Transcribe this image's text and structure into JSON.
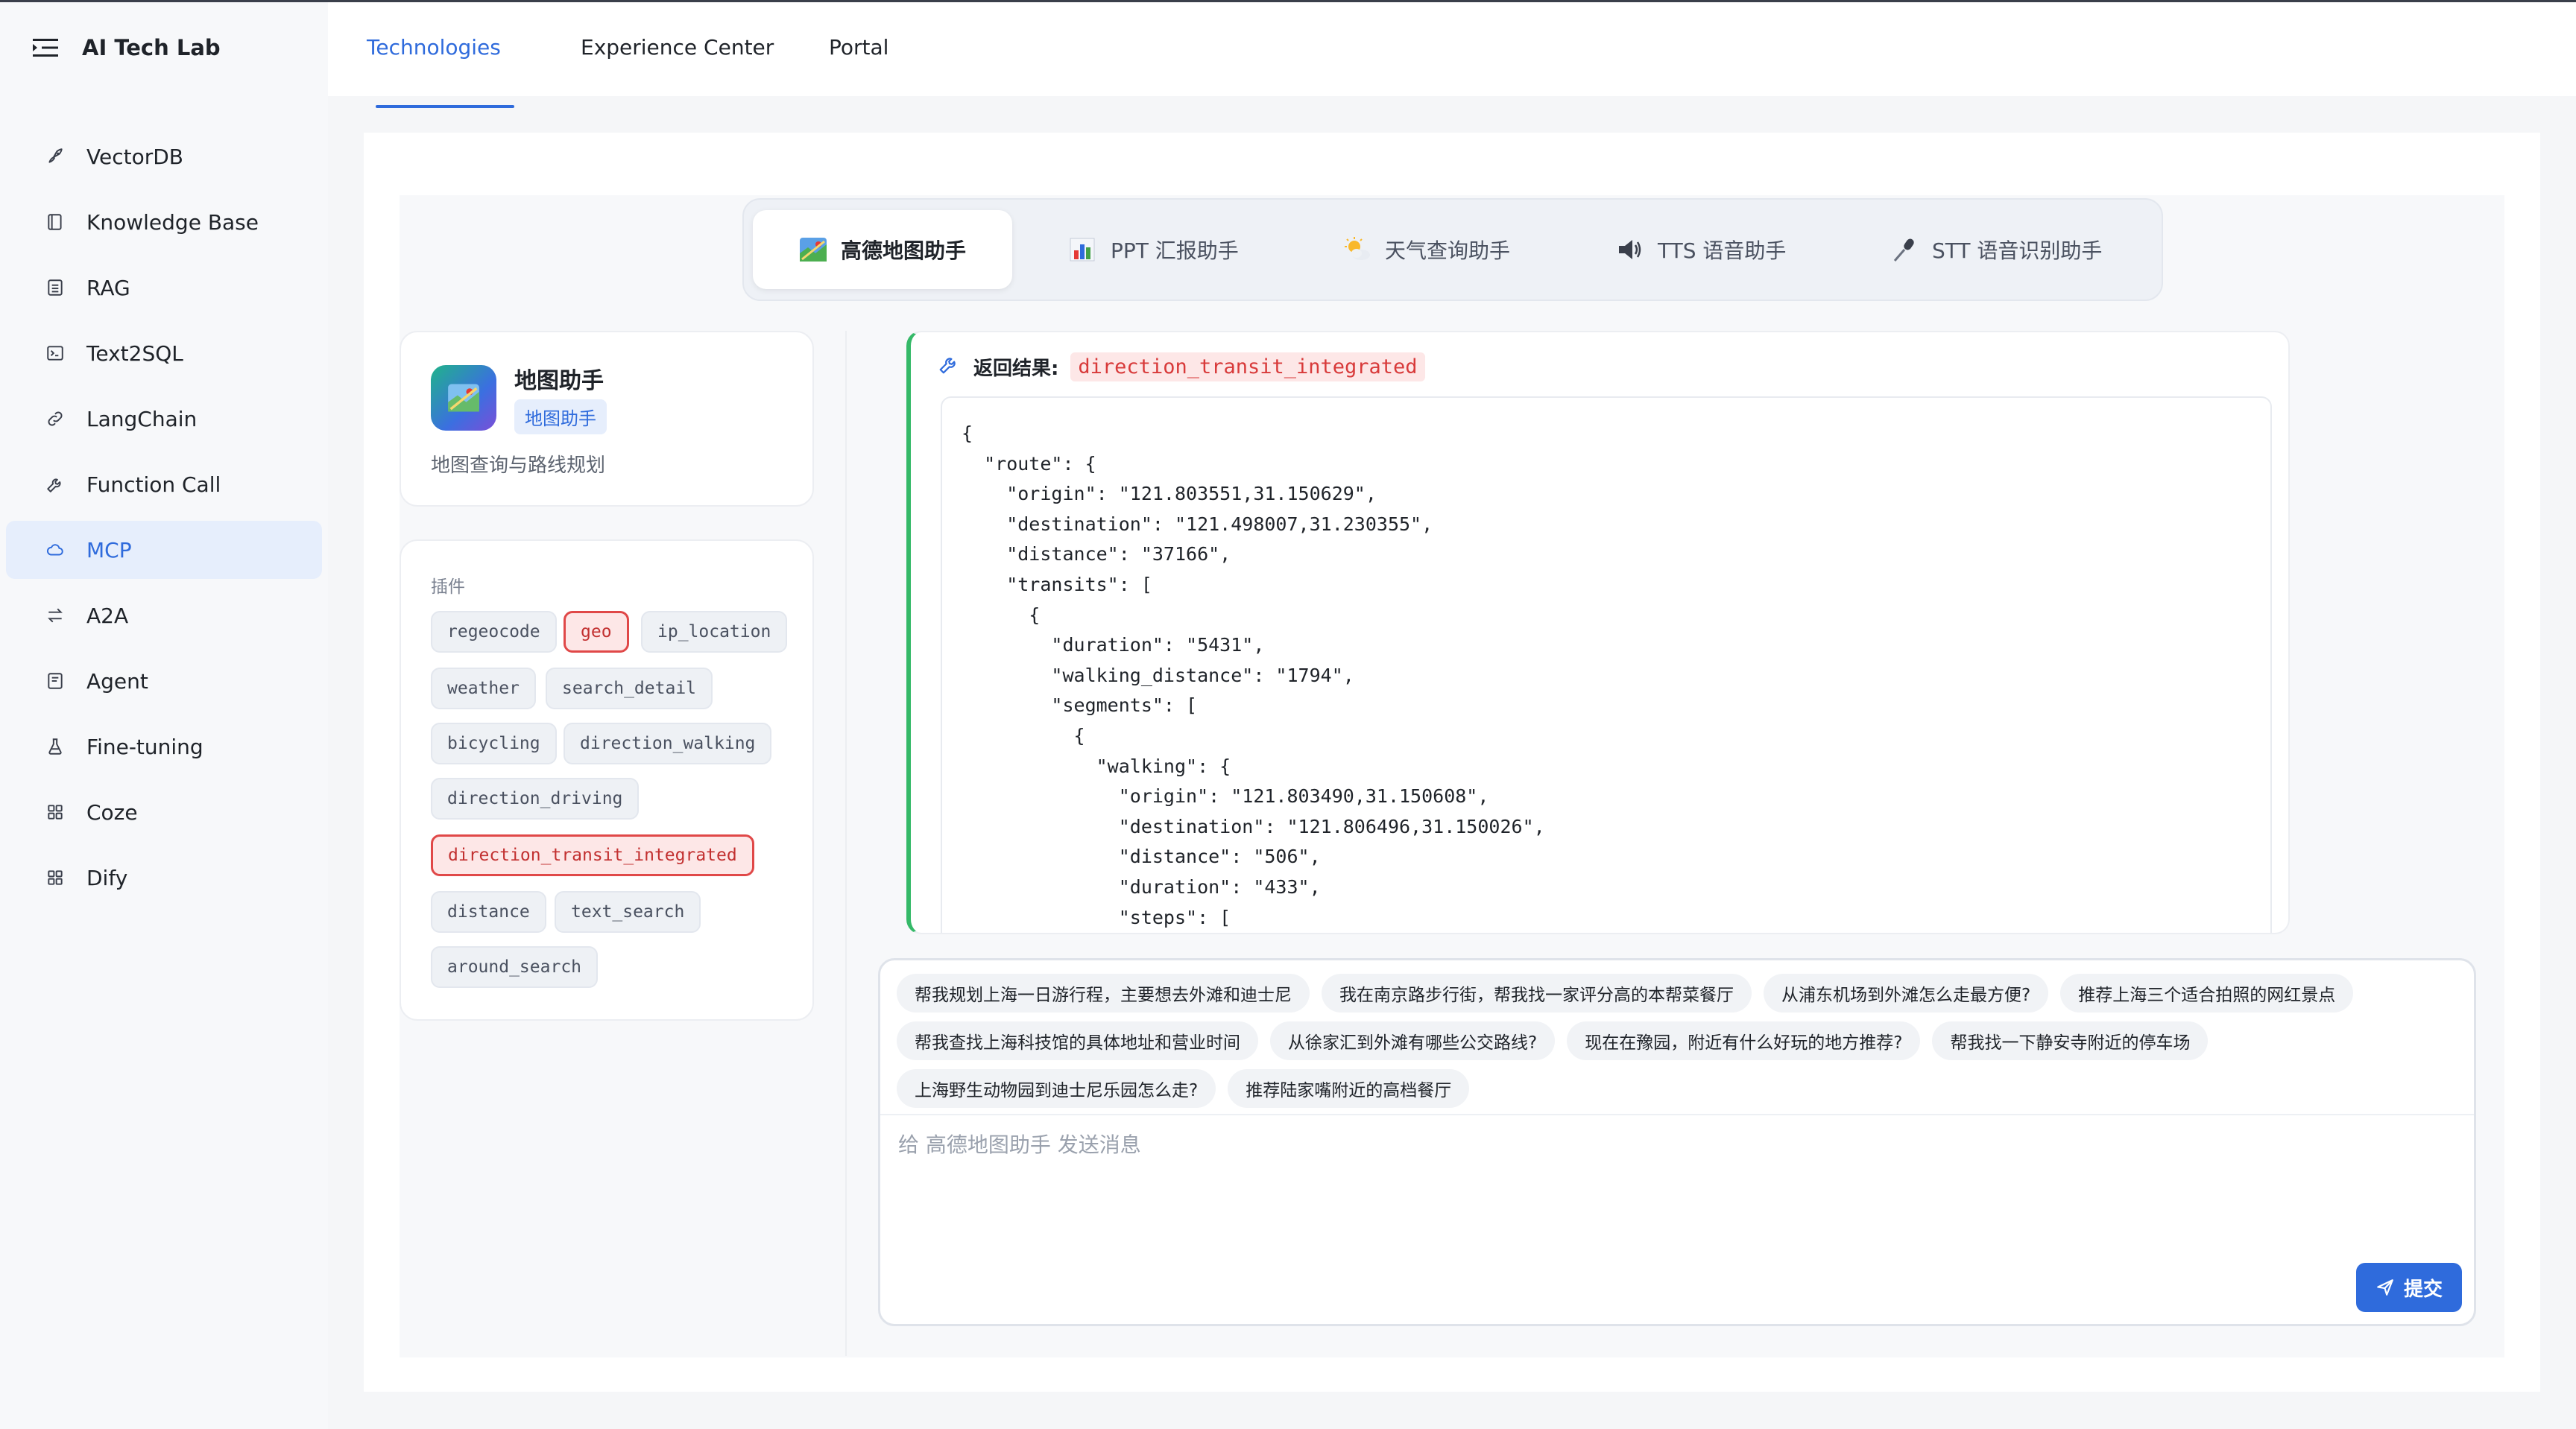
{
  "app": {
    "title": "AI Tech Lab"
  },
  "sidebar": {
    "items": [
      {
        "label": "VectorDB",
        "icon": "rocket-icon",
        "active": false
      },
      {
        "label": "Knowledge Base",
        "icon": "book-icon",
        "active": false
      },
      {
        "label": "RAG",
        "icon": "document-icon",
        "active": false
      },
      {
        "label": "Text2SQL",
        "icon": "terminal-icon",
        "active": false
      },
      {
        "label": "LangChain",
        "icon": "link-icon",
        "active": false
      },
      {
        "label": "Function Call",
        "icon": "wrench-icon",
        "active": false
      },
      {
        "label": "MCP",
        "icon": "cloud-icon",
        "active": true
      },
      {
        "label": "A2A",
        "icon": "swap-icon",
        "active": false
      },
      {
        "label": "Agent",
        "icon": "agent-icon",
        "active": false
      },
      {
        "label": "Fine-tuning",
        "icon": "flask-icon",
        "active": false
      },
      {
        "label": "Coze",
        "icon": "grid-icon",
        "active": false
      },
      {
        "label": "Dify",
        "icon": "grid-icon",
        "active": false
      }
    ]
  },
  "topnav": {
    "tabs": [
      {
        "label": "Technologies",
        "active": true
      },
      {
        "label": "Experience Center",
        "active": false
      },
      {
        "label": "Portal",
        "active": false
      }
    ]
  },
  "assistant_tabs": [
    {
      "label": "高德地图助手",
      "icon": "map-icon",
      "active": true
    },
    {
      "label": "PPT 汇报助手",
      "icon": "bar-chart-icon",
      "active": false
    },
    {
      "label": "天气查询助手",
      "icon": "sun-cloud-icon",
      "active": false
    },
    {
      "label": "TTS 语音助手",
      "icon": "speaker-icon",
      "active": false
    },
    {
      "label": "STT 语音识别助手",
      "icon": "microphone-icon",
      "active": false
    }
  ],
  "agent": {
    "name": "地图助手",
    "tag": "地图助手",
    "description": "地图查询与路线规划"
  },
  "plugins": {
    "title": "插件",
    "items": [
      {
        "label": "regeocode",
        "highlighted": false
      },
      {
        "label": "geo",
        "highlighted": true
      },
      {
        "label": "ip_location",
        "highlighted": false
      },
      {
        "label": "weather",
        "highlighted": false
      },
      {
        "label": "search_detail",
        "highlighted": false
      },
      {
        "label": "bicycling",
        "highlighted": false
      },
      {
        "label": "direction_walking",
        "highlighted": false
      },
      {
        "label": "direction_driving",
        "highlighted": false
      },
      {
        "label": "direction_transit_integrated",
        "highlighted": true
      },
      {
        "label": "distance",
        "highlighted": false
      },
      {
        "label": "text_search",
        "highlighted": false
      },
      {
        "label": "around_search",
        "highlighted": false
      }
    ]
  },
  "result": {
    "label": "返回结果:",
    "function_name": "direction_transit_integrated",
    "code": "{\n  \"route\": {\n    \"origin\": \"121.803551,31.150629\",\n    \"destination\": \"121.498007,31.230355\",\n    \"distance\": \"37166\",\n    \"transits\": [\n      {\n        \"duration\": \"5431\",\n        \"walking_distance\": \"1794\",\n        \"segments\": [\n          {\n            \"walking\": {\n              \"origin\": \"121.803490,31.150608\",\n              \"destination\": \"121.806496,31.150026\",\n              \"distance\": \"506\",\n              \"duration\": \"433\",\n              \"steps\": ["
  },
  "suggestions": [
    [
      "帮我规划上海一日游行程，主要想去外滩和迪士尼",
      "我在南京路步行街，帮我找一家评分高的本帮菜餐厅",
      "从浦东机场到外滩怎么走最方便?",
      "推荐上海三个适合拍照的网红景点"
    ],
    [
      "帮我查找上海科技馆的具体地址和营业时间",
      "从徐家汇到外滩有哪些公交路线?",
      "现在在豫园，附近有什么好玩的地方推荐?",
      "帮我找一下静安寺附近的停车场"
    ],
    [
      "上海野生动物园到迪士尼乐园怎么走?",
      "推荐陆家嘴附近的高档餐厅"
    ]
  ],
  "input": {
    "placeholder": "给 高德地图助手 发送消息",
    "value": "",
    "send_label": "提交"
  },
  "colors": {
    "accent": "#2f6bdc",
    "success_border": "#35b968",
    "highlight_red": "#e04848"
  }
}
